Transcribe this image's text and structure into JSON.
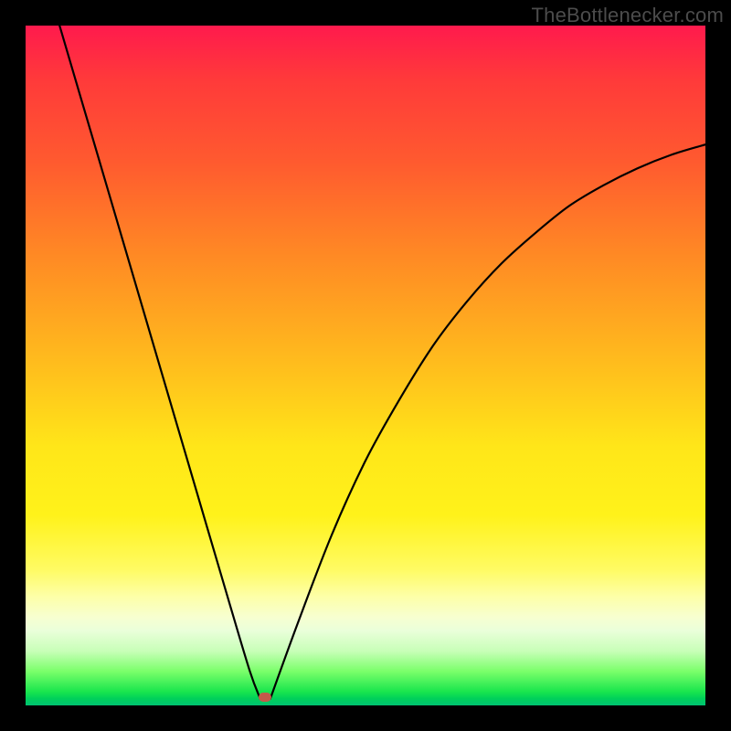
{
  "watermark": {
    "text": "TheBottlenecker.com"
  },
  "colors": {
    "background": "#000000",
    "curve_stroke": "#000000",
    "marker_fill": "#c45a4a",
    "watermark_color": "#4c4c4c",
    "gradient_stops": [
      "#ff1a4d",
      "#ff3a3a",
      "#ff5a2f",
      "#ff8a24",
      "#ffc41c",
      "#ffe619",
      "#fff21a",
      "#fffb63",
      "#fdffa8",
      "#f7ffd0",
      "#eaffda",
      "#c8ffb8",
      "#7aff6a",
      "#19e54d",
      "#00d05a",
      "#00c272"
    ]
  },
  "chart_data": {
    "type": "line",
    "title": "",
    "xlabel": "",
    "ylabel": "",
    "xlim": [
      0,
      1
    ],
    "ylim": [
      0,
      1
    ],
    "series": [
      {
        "name": "left-branch",
        "x": [
          0.05,
          0.1,
          0.15,
          0.2,
          0.25,
          0.3,
          0.33,
          0.345
        ],
        "y": [
          1.0,
          0.83,
          0.66,
          0.49,
          0.32,
          0.15,
          0.05,
          0.01
        ]
      },
      {
        "name": "right-branch",
        "x": [
          0.36,
          0.4,
          0.45,
          0.5,
          0.55,
          0.6,
          0.65,
          0.7,
          0.75,
          0.8,
          0.85,
          0.9,
          0.95,
          1.0
        ],
        "y": [
          0.01,
          0.12,
          0.25,
          0.36,
          0.45,
          0.53,
          0.595,
          0.65,
          0.695,
          0.735,
          0.765,
          0.79,
          0.81,
          0.825
        ]
      }
    ],
    "marker": {
      "x": 0.352,
      "y": 0.012
    },
    "description": "V-shaped bottleneck curve on vertical red-to-green gradient; minimum (optimal point) near x≈0.35, left branch linear, right branch concave asymptote near y≈0.83."
  }
}
